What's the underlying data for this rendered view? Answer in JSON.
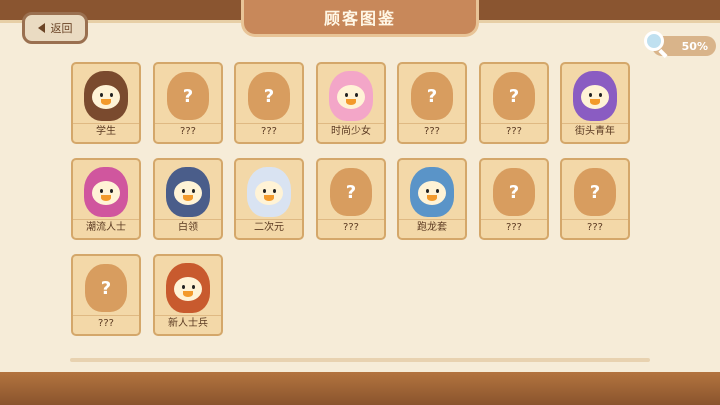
{
  "header": {
    "title": "顾客图鉴",
    "back_label": "返回"
  },
  "progress": {
    "label": "50%",
    "value": 0.5
  },
  "customers": [
    {
      "label": "学生",
      "unlocked": true,
      "color": "#7a4a2e"
    },
    {
      "label": "???",
      "unlocked": false
    },
    {
      "label": "???",
      "unlocked": false
    },
    {
      "label": "时尚少女",
      "unlocked": true,
      "color": "#f3a6c8"
    },
    {
      "label": "???",
      "unlocked": false
    },
    {
      "label": "???",
      "unlocked": false
    },
    {
      "label": "街头青年",
      "unlocked": true,
      "color": "#8a5cc2"
    },
    {
      "label": "潮流人士",
      "unlocked": true,
      "color": "#d0569e"
    },
    {
      "label": "白领",
      "unlocked": true,
      "color": "#4a5d8a"
    },
    {
      "label": "二次元",
      "unlocked": true,
      "color": "#d9e3f2"
    },
    {
      "label": "???",
      "unlocked": false
    },
    {
      "label": "跑龙套",
      "unlocked": true,
      "color": "#5a94c8"
    },
    {
      "label": "???",
      "unlocked": false
    },
    {
      "label": "???",
      "unlocked": false
    },
    {
      "label": "???",
      "unlocked": false
    },
    {
      "label": "新人士兵",
      "unlocked": true,
      "color": "#c85a2e"
    }
  ],
  "locked_mark": "?"
}
